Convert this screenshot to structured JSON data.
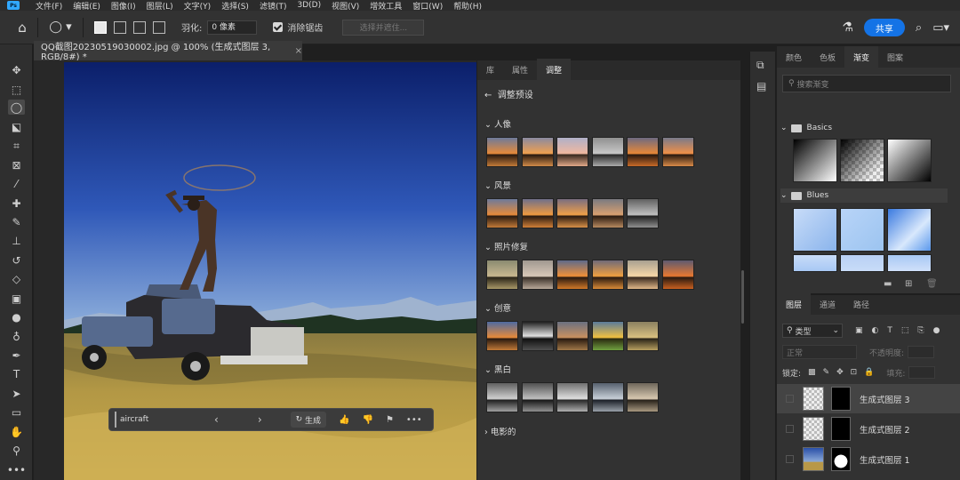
{
  "menu": [
    "文件(F)",
    "编辑(E)",
    "图像(I)",
    "图层(L)",
    "文字(Y)",
    "选择(S)",
    "滤镜(T)",
    "3D(D)",
    "视图(V)",
    "增效工具",
    "窗口(W)",
    "帮助(H)"
  ],
  "options": {
    "feather_label": "羽化:",
    "feather_value": "0 像素",
    "antialias_label": "消除锯齿",
    "select_mask_label": "选择并遮住...",
    "share_label": "共享"
  },
  "document": {
    "tab_title": "QQ截图20230519030002.jpg @ 100% (生成式图层 3, RGB/8#) *",
    "close": "×"
  },
  "context_bar": {
    "prompt": "aircraft",
    "generate_label": "生成",
    "more": "•••"
  },
  "adjustments": {
    "tabs": [
      "库",
      "属性",
      "调整"
    ],
    "active_tab": "调整",
    "header": "调整预设",
    "categories": [
      {
        "label": "人像",
        "thumbs": 6
      },
      {
        "label": "风景",
        "thumbs": 5
      },
      {
        "label": "照片修复",
        "thumbs": 6
      },
      {
        "label": "创意",
        "thumbs": 5
      },
      {
        "label": "黑白",
        "thumbs": 5
      },
      {
        "label": "电影的",
        "thumbs": 0
      }
    ]
  },
  "gradients": {
    "tabs": [
      "颜色",
      "色板",
      "渐变",
      "图案"
    ],
    "active_tab": "渐变",
    "search_placeholder": "搜索渐变",
    "folders": [
      "Basics",
      "Blues"
    ]
  },
  "layers": {
    "tabs": [
      "图层",
      "通道",
      "路径"
    ],
    "filter_kind": "类型",
    "blend_mode": "正常",
    "opacity_label": "不透明度:",
    "lock_label": "锁定:",
    "fill_label": "填充:",
    "items": [
      "生成式图层 3",
      "生成式图层 2",
      "生成式图层 1"
    ],
    "selected": "生成式图层 3"
  },
  "colors": {
    "accent": "#1473e6",
    "panel": "#323232"
  }
}
